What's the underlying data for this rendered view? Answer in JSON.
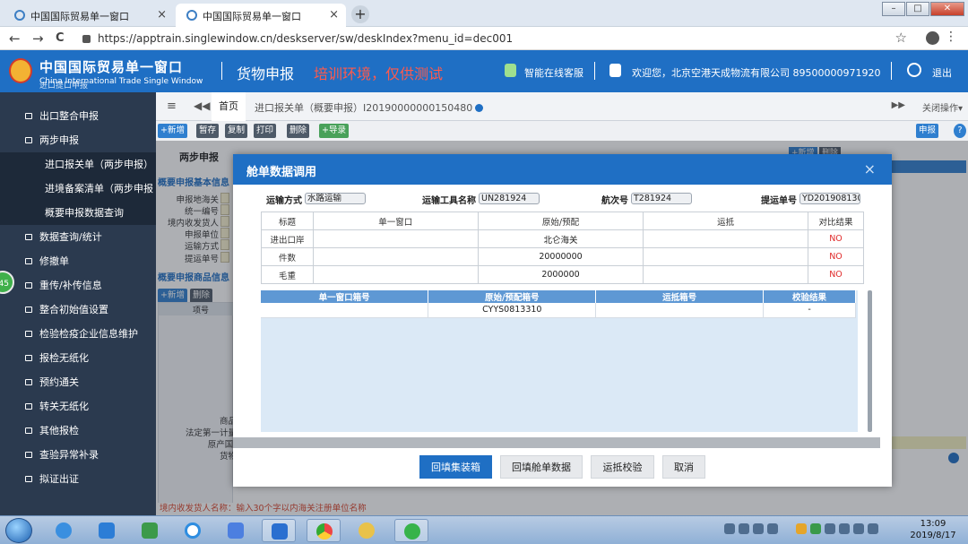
{
  "browser": {
    "tabs": [
      {
        "title": "中国国际贸易单一窗口",
        "close": "×"
      },
      {
        "title": "中国国际贸易单一窗口",
        "close": "×"
      }
    ],
    "new_tab": "+",
    "window_buttons": {
      "minimize": "–",
      "maximize": "□",
      "close": "✕"
    },
    "url": "https://apptrain.singlewindow.cn/deskserver/sw/deskIndex?menu_id=dec001",
    "back": "←",
    "forward": "→",
    "reload": "C",
    "bookmark": "☆",
    "menu": "⋮"
  },
  "header": {
    "title_cn": "中国国际贸易单一窗口",
    "title_en": "China International Trade Single Window",
    "section": "货物申报",
    "env_notice": "培训环境，仅供测试",
    "service": "智能在线客服",
    "welcome": "欢迎您，北京空港天成物流有限公司 89500000971920",
    "logout": "退出"
  },
  "sidebar": {
    "top_partial": "进口提口申报",
    "items": [
      {
        "label": "出口整合申报"
      },
      {
        "label": "两步申报"
      },
      {
        "label": "数据查询/统计"
      },
      {
        "label": "修撤单"
      },
      {
        "label": "重传/补传信息"
      },
      {
        "label": "整合初始值设置"
      },
      {
        "label": "检验检疫企业信息维护"
      },
      {
        "label": "报检无纸化"
      },
      {
        "label": "预约通关"
      },
      {
        "label": "转关无纸化"
      },
      {
        "label": "其他报检"
      },
      {
        "label": "查验异常补录"
      },
      {
        "label": "拟证出证"
      }
    ],
    "subitems": [
      {
        "label": "进口报关单（两步申报）"
      },
      {
        "label": "进境备案清单（两步申报"
      },
      {
        "label": "概要申报数据查询"
      }
    ],
    "badge": "45"
  },
  "tabstrip": {
    "menu_icon": "≡",
    "back_icon": "◀◀",
    "home": "首页",
    "page_tab": "进口报关单（概要申报）I20190000000150480",
    "forward_icon": "▶▶",
    "close_ops": "关闭操作▾"
  },
  "toolbar": {
    "buttons": [
      {
        "label": "+新增"
      },
      {
        "label": "暂存"
      },
      {
        "label": "复制"
      },
      {
        "label": "打印"
      },
      {
        "label": "删除"
      },
      {
        "label": "+导录"
      }
    ],
    "declare": "申报",
    "help": "?"
  },
  "background": {
    "title": "两步申报",
    "section1": "概要申报基本信息",
    "labels": [
      "申报地海关",
      "统一编号",
      "境内收发货人",
      "申报单位",
      "运输方式",
      "提运单号"
    ],
    "section2": "概要申报商品信息",
    "grid_buttons": [
      "+新增",
      "删除"
    ],
    "grid_col": "项号",
    "bottom_labels": [
      "商品",
      "法定第一计量",
      "原产国(",
      "货物"
    ],
    "right_buttons": [
      "+新增",
      "删除"
    ],
    "status_hint": "境内收发货人名称：输入30个字以内海关注册单位名称"
  },
  "modal": {
    "title": "舱单数据调用",
    "close": "×",
    "fields": [
      {
        "label": "运输方式",
        "value": "水路运输"
      },
      {
        "label": "运输工具名称",
        "value": "UN281924"
      },
      {
        "label": "航次号",
        "value": "T281924"
      },
      {
        "label": "提运单号",
        "value": "YD2019081304"
      }
    ],
    "compare_headers": [
      "标题",
      "单一窗口",
      "原始/预配",
      "运抵",
      "对比结果"
    ],
    "compare_rows": [
      {
        "title": "进出口岸",
        "sw": "",
        "orig": "北仑海关",
        "arr": "",
        "result": "NO"
      },
      {
        "title": "件数",
        "sw": "",
        "orig": "20000000",
        "arr": "",
        "result": "NO"
      },
      {
        "title": "毛重",
        "sw": "",
        "orig": "2000000",
        "arr": "",
        "result": "NO"
      }
    ],
    "box_headers": [
      "单一窗口箱号",
      "原始/预配箱号",
      "运抵箱号",
      "校验结果"
    ],
    "box_rows": [
      {
        "sw": "",
        "orig": "CYYS0813310",
        "arr": "",
        "result": "-"
      }
    ],
    "buttons": {
      "fill_container": "回填集装箱",
      "fill_manifest": "回填舱单数据",
      "arrival_check": "运抵校验",
      "cancel": "取消"
    }
  },
  "taskbar": {
    "time": "13:09",
    "date": "2019/8/17"
  },
  "colors": {
    "brand_blue": "#1f6fc4",
    "sidebar_bg": "#2b3a4f",
    "alert_red": "#e02a2a",
    "env_red": "#ff5a4c"
  }
}
